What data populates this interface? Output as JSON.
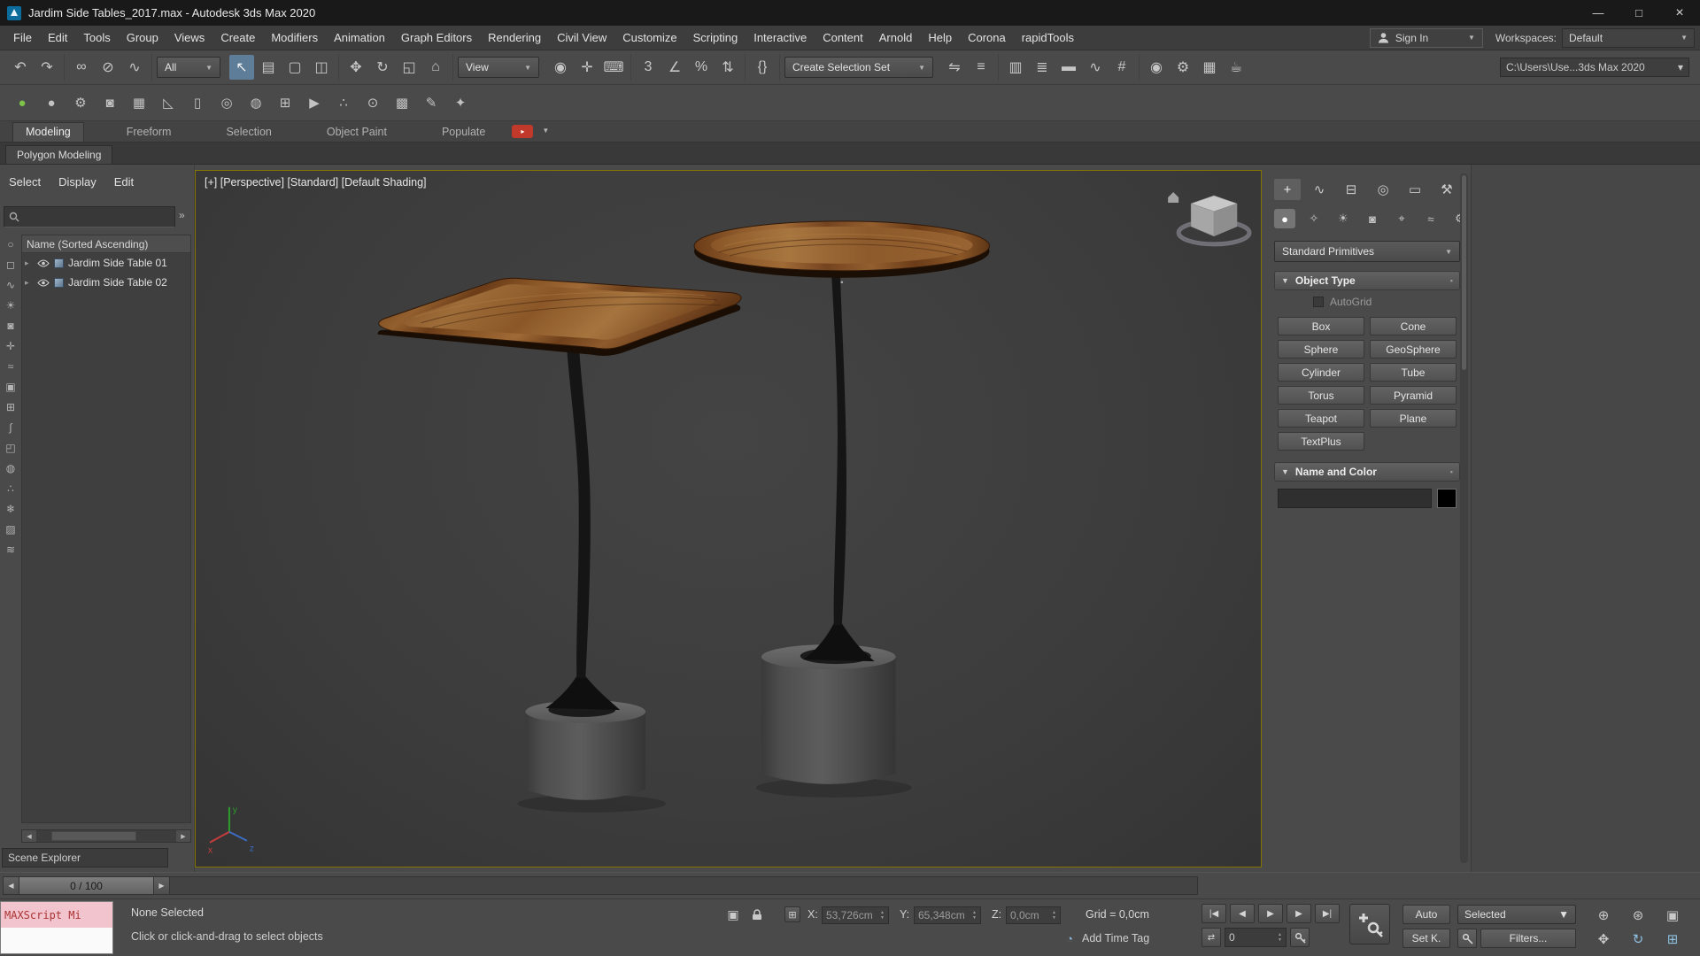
{
  "ui": {
    "caret": "▼",
    "caret_small": "▾",
    "chevron_right": "»",
    "expander": "▸",
    "spinner_up": "▲",
    "spinner_down": "▼",
    "left_arrow": "◀",
    "right_arrow": "▶",
    "play_small": "▸"
  },
  "colors": {
    "accent_blue": "#5d7d99",
    "viewport_border": "#847404",
    "wood_brown": "#8a5627",
    "maxscript_pink": "#f2c4cd",
    "name_color_swatch": "#000000"
  },
  "title_bar": {
    "title": "Jardim Side Tables_2017.max - Autodesk 3ds Max 2020",
    "minimize_glyph": "—",
    "maximize_glyph": "□",
    "close_glyph": "×"
  },
  "menu_bar": {
    "menus": [
      "File",
      "Edit",
      "Tools",
      "Group",
      "Views",
      "Create",
      "Modifiers",
      "Animation",
      "Graph Editors",
      "Rendering",
      "Civil View",
      "Customize",
      "Scripting",
      "Interactive",
      "Content",
      "Arnold",
      "Help",
      "Corona",
      "rapidTools"
    ],
    "sign_in": "Sign In",
    "workspaces_label": "Workspaces:",
    "workspace": "Default"
  },
  "toolbar": {
    "filter_dropdown": "All",
    "view_dropdown": "View",
    "selection_set_dropdown": "Create Selection Set",
    "project_path": "C:\\Users\\Use...3ds Max 2020",
    "g1": [
      {
        "name": "undo-icon",
        "glyph": "↶"
      },
      {
        "name": "redo-icon",
        "glyph": "↷"
      }
    ],
    "g2": [
      {
        "name": "select-and-link-icon",
        "glyph": "∞"
      },
      {
        "name": "unlink-selection-icon",
        "glyph": "⊘"
      },
      {
        "name": "bind-to-space-warp-icon",
        "glyph": "∿"
      }
    ],
    "g3": [
      {
        "name": "select-object-icon",
        "glyph": "↖",
        "state": "active"
      },
      {
        "name": "select-by-name-icon",
        "glyph": "▤"
      },
      {
        "name": "rectangular-selection-region-icon",
        "glyph": "▢"
      },
      {
        "name": "window-crossing-toggle-icon",
        "glyph": "◫"
      }
    ],
    "g4": [
      {
        "name": "select-and-move-icon",
        "glyph": "✥"
      },
      {
        "name": "select-and-rotate-icon",
        "glyph": "↻"
      },
      {
        "name": "select-and-scale-icon",
        "glyph": "◱"
      },
      {
        "name": "select-and-place-icon",
        "glyph": "⌂"
      }
    ],
    "g5": [
      {
        "name": "use-pivot-point-center-icon",
        "glyph": "◉"
      },
      {
        "name": "select-and-manipulate-icon",
        "glyph": "✛"
      },
      {
        "name": "keyboard-shortcut-override-icon",
        "glyph": "⌨"
      }
    ],
    "g6": [
      {
        "name": "snaps-toggle-icon",
        "glyph": "3"
      },
      {
        "name": "angle-snap-toggle-icon",
        "glyph": "∠"
      },
      {
        "name": "percent-snap-toggle-icon",
        "glyph": "%"
      },
      {
        "name": "spinner-snap-toggle-icon",
        "glyph": "⇅"
      }
    ],
    "g7": [
      {
        "name": "edit-named-selection-sets-icon",
        "glyph": "{}"
      }
    ],
    "g8": [
      {
        "name": "mirror-icon",
        "glyph": "⇋"
      },
      {
        "name": "align-icon",
        "glyph": "≡"
      }
    ],
    "g9": [
      {
        "name": "toggle-scene-explorer-icon",
        "glyph": "▥"
      },
      {
        "name": "toggle-layer-explorer-icon",
        "glyph": "≣"
      },
      {
        "name": "toggle-ribbon-icon",
        "glyph": "▬"
      },
      {
        "name": "curve-editor-icon",
        "glyph": "∿"
      },
      {
        "name": "schematic-view-icon",
        "glyph": "#"
      }
    ],
    "g10": [
      {
        "name": "material-editor-icon",
        "glyph": "◉"
      },
      {
        "name": "render-setup-icon",
        "glyph": "⚙"
      },
      {
        "name": "rendered-frame-window-icon",
        "glyph": "▦"
      },
      {
        "name": "render-production-icon",
        "glyph": "☕"
      }
    ],
    "row2": [
      {
        "name": "corona-sphere-icon",
        "glyph": "●",
        "color": "#7ec24a"
      },
      {
        "name": "gray-sphere-icon",
        "glyph": "●"
      },
      {
        "name": "gears-icon",
        "glyph": "⚙"
      },
      {
        "name": "camera-tool-icon",
        "glyph": "◙"
      },
      {
        "name": "spreadsheet-icon",
        "glyph": "▦"
      },
      {
        "name": "ramp-icon",
        "glyph": "◺"
      },
      {
        "name": "page-icon",
        "glyph": "▯"
      },
      {
        "name": "torus-tool-icon",
        "glyph": "◎"
      },
      {
        "name": "wire-sphere-icon",
        "glyph": "◍"
      },
      {
        "name": "add-box-icon",
        "glyph": "⊞"
      },
      {
        "name": "play-box-icon",
        "glyph": "▶"
      },
      {
        "name": "scatter-icon",
        "glyph": "∴"
      },
      {
        "name": "eye-tool-icon",
        "glyph": "⊙"
      },
      {
        "name": "grid-tool-icon",
        "glyph": "▩"
      },
      {
        "name": "pencil-icon",
        "glyph": "✎"
      },
      {
        "name": "lightbulb-icon",
        "glyph": "✦"
      }
    ]
  },
  "ribbon": {
    "tabs": [
      {
        "label": "Modeling",
        "state": "active"
      },
      {
        "label": "Freeform"
      },
      {
        "label": "Selection"
      },
      {
        "label": "Object Paint"
      },
      {
        "label": "Populate"
      }
    ],
    "subtab": "Polygon Modeling"
  },
  "scene_explorer": {
    "menu": [
      "Select",
      "Display",
      "Edit"
    ],
    "column_header": "Name (Sorted Ascending)",
    "rows": [
      {
        "label": "Jardim Side Table 01"
      },
      {
        "label": "Jardim Side Table 02"
      }
    ],
    "filters": [
      {
        "name": "display-all-icon",
        "glyph": "○"
      },
      {
        "name": "display-geometry-icon",
        "glyph": "◻"
      },
      {
        "name": "display-shapes-icon",
        "glyph": "∿"
      },
      {
        "name": "display-lights-icon",
        "glyph": "☀"
      },
      {
        "name": "display-cameras-icon",
        "glyph": "◙"
      },
      {
        "name": "display-helpers-icon",
        "glyph": "✛"
      },
      {
        "name": "display-spacewarps-icon",
        "glyph": "≈"
      },
      {
        "name": "display-groups-icon",
        "glyph": "▣"
      },
      {
        "name": "display-xrefs-icon",
        "glyph": "⊞"
      },
      {
        "name": "display-bones-icon",
        "glyph": "∫"
      },
      {
        "name": "display-containers-icon",
        "glyph": "◰"
      },
      {
        "name": "display-materials-icon",
        "glyph": "◍"
      },
      {
        "name": "display-particles-icon",
        "glyph": "∴"
      },
      {
        "name": "display-frozen-icon",
        "glyph": "❄"
      },
      {
        "name": "display-hidden-icon",
        "glyph": "▨"
      },
      {
        "name": "display-layers-icon",
        "glyph": "≋"
      }
    ],
    "footer": "Scene Explorer"
  },
  "viewport": {
    "label": "[+] [Perspective] [Standard] [Default Shading]",
    "axis": {
      "x": "x",
      "y": "y",
      "z": "z"
    }
  },
  "command_panel": {
    "tabs": [
      {
        "name": "create-tab-icon",
        "glyph": "+",
        "state": "active"
      },
      {
        "name": "modify-tab-icon",
        "glyph": "∿"
      },
      {
        "name": "hierarchy-tab-icon",
        "glyph": "⊟"
      },
      {
        "name": "motion-tab-icon",
        "glyph": "◎"
      },
      {
        "name": "display-tab-icon",
        "glyph": "▭"
      },
      {
        "name": "utilities-tab-icon",
        "glyph": "⚒"
      }
    ],
    "categories": [
      {
        "name": "geometry-category-icon",
        "glyph": "●",
        "state": "active"
      },
      {
        "name": "shapes-category-icon",
        "glyph": "✧"
      },
      {
        "name": "lights-category-icon",
        "glyph": "☀"
      },
      {
        "name": "cameras-category-icon",
        "glyph": "◙"
      },
      {
        "name": "helpers-category-icon",
        "glyph": "⌖"
      },
      {
        "name": "spacewarps-category-icon",
        "glyph": "≈"
      },
      {
        "name": "systems-category-icon",
        "glyph": "⚙"
      }
    ],
    "primitive_dropdown": "Standard Primitives",
    "object_type": {
      "title": "Object Type",
      "autogrid_label": "AutoGrid",
      "buttons": [
        "Box",
        "Cone",
        "Sphere",
        "GeoSphere",
        "Cylinder",
        "Tube",
        "Torus",
        "Pyramid",
        "Teapot",
        "Plane",
        "TextPlus"
      ]
    },
    "name_and_color": {
      "title": "Name and Color"
    }
  },
  "timeline": {
    "slider_label": "0 / 100"
  },
  "status_bar": {
    "maxscript_label": "MAXScript Mi",
    "selection_status": "None Selected",
    "prompt": "Click or click-and-drag to select objects",
    "x_label": "X:",
    "x_value": "53,726cm",
    "y_label": "Y:",
    "y_value": "65,348cm",
    "z_label": "Z:",
    "z_value": "0,0cm",
    "grid_label": "Grid = 0,0cm",
    "add_time_tag": "Add Time Tag",
    "frame_value": "0"
  },
  "animation": {
    "playback": [
      {
        "name": "go-to-start-button",
        "glyph": "|◀"
      },
      {
        "name": "previous-frame-button",
        "glyph": "◀"
      },
      {
        "name": "play-button",
        "glyph": "▶"
      },
      {
        "name": "next-frame-button",
        "glyph": "▶"
      },
      {
        "name": "go-to-end-button",
        "glyph": "▶|"
      }
    ],
    "key_mode_glyph": "⇄",
    "auto_key": "Auto",
    "set_key": "Set K.",
    "selected_dropdown": "Selected",
    "filters_button": "Filters..."
  },
  "nav": {
    "buttons": [
      {
        "name": "zoom-icon",
        "glyph": "⊕"
      },
      {
        "name": "zoom-all-icon",
        "glyph": "⊛"
      },
      {
        "name": "zoom-extents-icon",
        "glyph": "▣"
      },
      {
        "name": "pan-icon",
        "glyph": "✥"
      },
      {
        "name": "orbit-icon",
        "glyph": "↻",
        "color": "#8fc1e3"
      },
      {
        "name": "maximize-viewport-toggle-icon",
        "glyph": "⊞",
        "color": "#8fc1e3"
      }
    ]
  }
}
